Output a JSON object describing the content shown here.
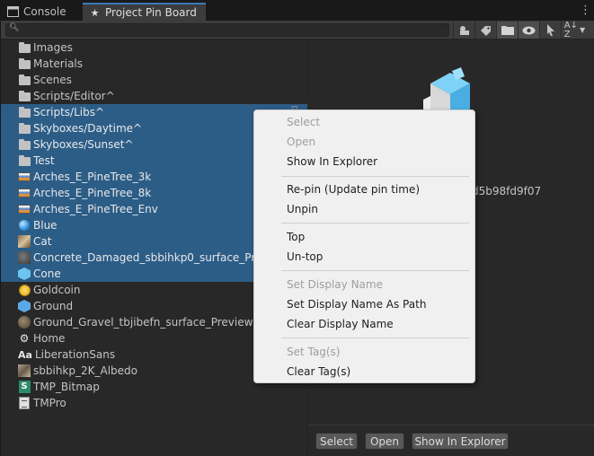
{
  "tabs": [
    {
      "label": "Console",
      "icon": "console-icon"
    },
    {
      "label": "Project Pin Board",
      "icon": "star-icon",
      "active": true
    }
  ],
  "toolbar": {
    "search_value": "",
    "buttons": [
      "filter-icon",
      "tag-icon",
      "folder-icon",
      "eye-icon",
      "pointer-icon",
      "sort-az-icon"
    ]
  },
  "list": {
    "items": [
      {
        "label": "Images",
        "icon": "folder-icon",
        "selected": false
      },
      {
        "label": "Materials",
        "icon": "folder-icon",
        "selected": false
      },
      {
        "label": "Scenes",
        "icon": "folder-icon",
        "selected": false
      },
      {
        "label": "Scripts/Editor^",
        "icon": "folder-icon",
        "selected": false
      },
      {
        "label": "Scripts/Libs^",
        "icon": "folder-icon",
        "selected": true
      },
      {
        "label": "Skyboxes/Daytime^",
        "icon": "folder-icon",
        "selected": true
      },
      {
        "label": "Skyboxes/Sunset^",
        "icon": "folder-icon",
        "selected": true
      },
      {
        "label": "Test",
        "icon": "folder-icon",
        "selected": true
      },
      {
        "label": "Arches_E_PineTree_3k",
        "icon": "skybox-icon",
        "selected": true
      },
      {
        "label": "Arches_E_PineTree_8k",
        "icon": "skybox-icon",
        "selected": true
      },
      {
        "label": "Arches_E_PineTree_Env",
        "icon": "skybox-icon",
        "selected": true
      },
      {
        "label": "Blue",
        "icon": "material-ball-icon",
        "selected": true
      },
      {
        "label": "Cat",
        "icon": "cat-texture-icon",
        "selected": true
      },
      {
        "label": "Concrete_Damaged_sbbihkp0_surface_Preview",
        "icon": "concrete-texture-icon",
        "selected": true
      },
      {
        "label": "Cone",
        "icon": "prefab-icon",
        "selected": true
      },
      {
        "label": "Goldcoin",
        "icon": "coin-icon",
        "selected": false
      },
      {
        "label": "Ground",
        "icon": "prefab-icon",
        "selected": false
      },
      {
        "label": "Ground_Gravel_tbjibefn_surface_Preview",
        "icon": "gravel-texture-icon",
        "selected": false
      },
      {
        "label": "Home",
        "icon": "unity-scene-icon",
        "selected": false
      },
      {
        "label": "LiberationSans",
        "icon": "font-icon",
        "selected": false
      },
      {
        "label": "sbbihkp_2K_Albedo",
        "icon": "albedo-texture-icon",
        "selected": false
      },
      {
        "label": "TMP_Bitmap",
        "icon": "shader-icon",
        "selected": false
      },
      {
        "label": "TMPro",
        "icon": "text-file-icon",
        "selected": false
      }
    ]
  },
  "detail": {
    "guid_fragment": "d5b98fd9f07",
    "buttons": {
      "select": "Select",
      "open": "Open",
      "show_in_explorer": "Show In Explorer"
    },
    "preview_icon": "package-cube-icon",
    "accent": "#5bc0f0"
  },
  "menu": {
    "items": {
      "select": "Select",
      "open": "Open",
      "show_in_explorer": "Show In Explorer",
      "repin": "Re-pin (Update pin time)",
      "unpin": "Unpin",
      "top": "Top",
      "untop": "Un-top",
      "set_display_name": "Set Display Name",
      "set_display_name_as_path": "Set Display Name As Path",
      "clear_display_name": "Clear Display Name",
      "set_tags": "Set Tag(s)",
      "clear_tags": "Clear Tag(s)"
    },
    "disabled": [
      "select",
      "open",
      "set_display_name",
      "set_tags"
    ]
  },
  "colors": {
    "selection": "#2c5d87",
    "tab_accent": "#3a79bb",
    "menu_bg": "#f0f0f0"
  }
}
